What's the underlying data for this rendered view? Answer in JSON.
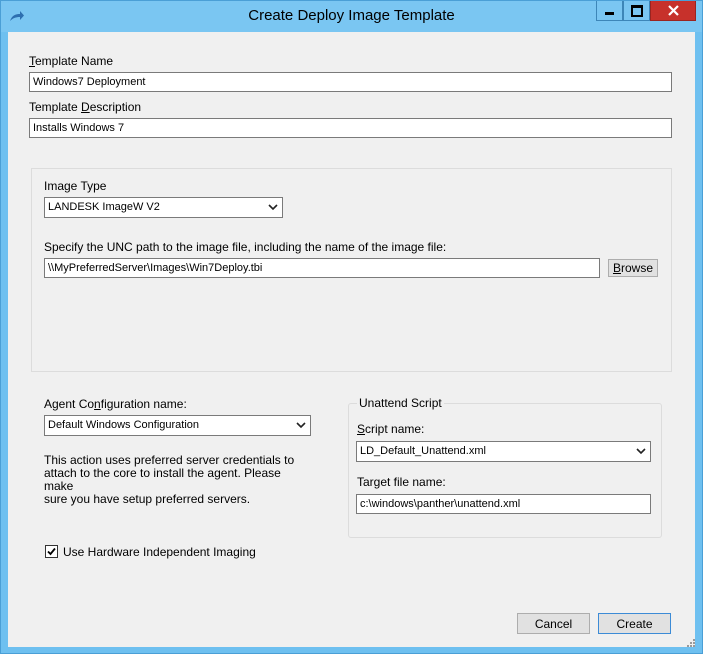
{
  "window": {
    "title": "Create Deploy Image Template"
  },
  "form": {
    "template_name": {
      "label_key": "T",
      "label_rest": "emplate Name",
      "value": "Windows7 Deployment"
    },
    "template_description": {
      "label_pre": "Template ",
      "label_key": "D",
      "label_rest": "escription",
      "value": "Installs Windows 7"
    },
    "image_type": {
      "label": "Image Type",
      "selected": "LANDESK ImageW V2"
    },
    "unc_path": {
      "label": "Specify the UNC path to the image file, including the name of the image file:",
      "value": "\\\\MyPreferredServer\\Images\\Win7Deploy.tbi",
      "browse_key": "B",
      "browse_rest": "rowse"
    },
    "agent_config": {
      "label_pre": "Agent Co",
      "label_key": "n",
      "label_rest": "figuration name:",
      "selected": "Default Windows Configuration",
      "info": "This action uses preferred server credentials to\nattach to the core to install the agent.  Please make\nsure you have setup preferred servers."
    },
    "unattend": {
      "group_title": "Unattend Script",
      "script_label_key": "S",
      "script_label_rest": "cript name:",
      "script_selected": "LD_Default_Unattend.xml",
      "target_label": "Target file name:",
      "target_value": "c:\\windows\\panther\\unattend.xml"
    },
    "hii": {
      "label": "Use Hardware Independent Imaging",
      "checked": true
    }
  },
  "buttons": {
    "cancel": "Cancel",
    "create": "Create"
  },
  "colors": {
    "titlebar": "#7ac6f2",
    "close_button": "#c7312b",
    "client": "#f0f0f0"
  }
}
